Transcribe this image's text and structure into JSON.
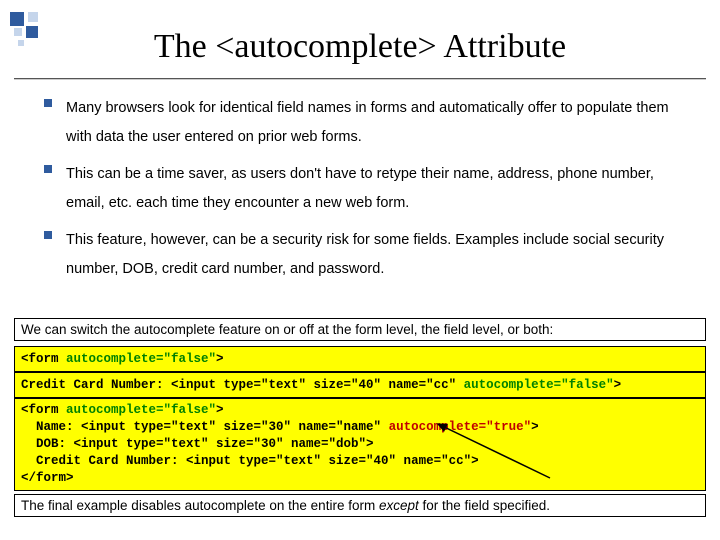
{
  "title": "The <autocomplete> Attribute",
  "bullets": [
    "Many browsers look for identical field names in forms and automatically offer to populate them with data the user entered on prior web forms.",
    "This can be a time saver, as users don't have to retype their name, address, phone number, email, etc. each time they encounter a new web form.",
    "This feature, however, can be a security risk for some fields.  Examples include social security number, DOB, credit card number, and password."
  ],
  "note_top": "We can switch the autocomplete feature on or off at the form level, the field level, or both:",
  "code1": {
    "p1": "<form ",
    "p2": "autocomplete=\"false\"",
    "p3": ">"
  },
  "code2": {
    "p1": "Credit Card Number: <input type=\"text\" size=\"40\" name=\"cc\" ",
    "p2": "autocomplete=\"false\"",
    "p3": ">"
  },
  "code3": {
    "l1a": "<form ",
    "l1b": "autocomplete=\"false\"",
    "l1c": ">",
    "l2a": "  Name: <input type=\"text\" size=\"30\" name=\"name\" ",
    "l2b": "autocomplete=\"true\"",
    "l2c": ">",
    "l3": "  DOB: <input type=\"text\" size=\"30\" name=\"dob\">",
    "l4": "  Credit Card Number: <input type=\"text\" size=\"40\" name=\"cc\">",
    "l5": "</form>"
  },
  "note_bottom_a": "The final example disables autocomplete on the entire form ",
  "note_bottom_b": "except",
  "note_bottom_c": " for the field specified."
}
